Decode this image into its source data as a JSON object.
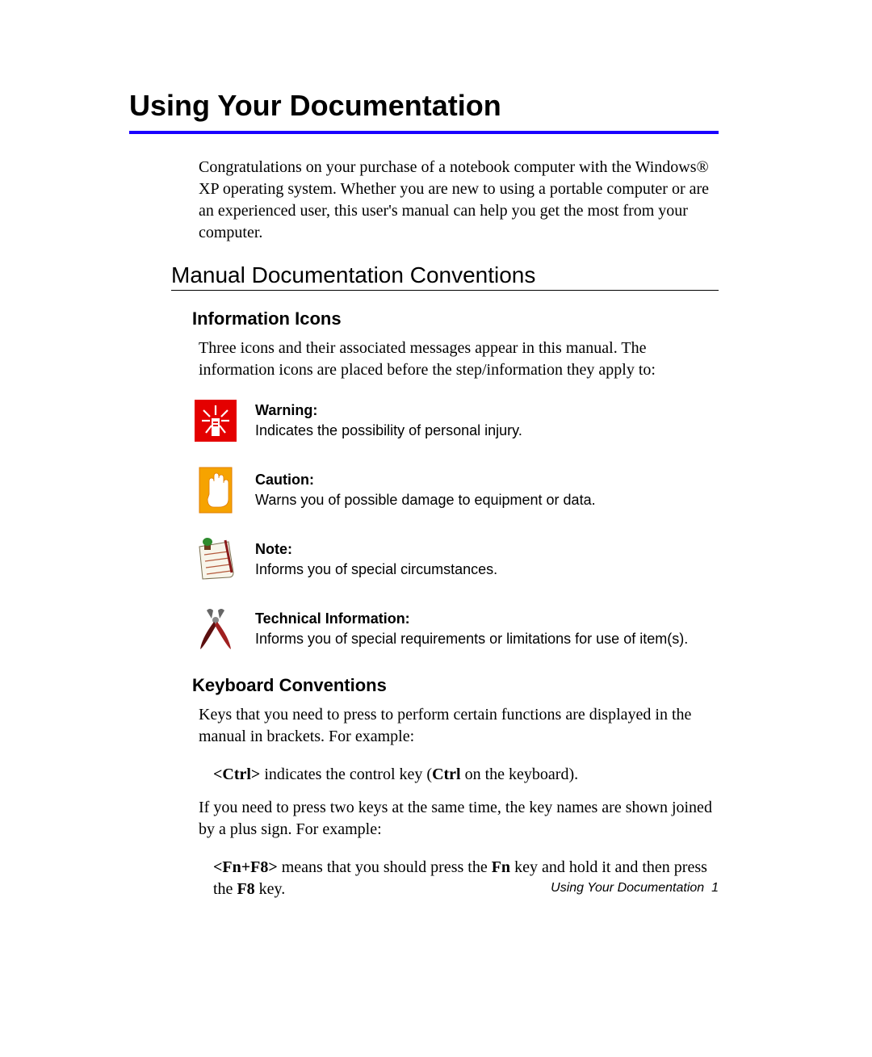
{
  "title": "Using Your Documentation",
  "intro": "Congratulations on your purchase of a notebook computer with the Windows® XP operating system. Whether you are new to using a portable computer or are an experienced user, this user's manual can help you get the most from your computer.",
  "section_heading": "Manual Documentation Conventions",
  "info_icons": {
    "heading": "Information Icons",
    "lead": "Three icons and their associated messages appear in this manual. The information icons are placed before the step/information they apply to:",
    "items": [
      {
        "icon": "warning-icon",
        "label": "Warning:",
        "desc": "Indicates the possibility of personal injury."
      },
      {
        "icon": "caution-icon",
        "label": "Caution:",
        "desc": "Warns you of possible damage to equipment or data."
      },
      {
        "icon": "note-icon",
        "label": "Note:",
        "desc": "Informs you of special circumstances."
      },
      {
        "icon": "tech-info-icon",
        "label": "Technical Information:",
        "desc": "Informs you of special requirements or limitations for use of item(s)."
      }
    ]
  },
  "keyboard": {
    "heading": "Keyboard Conventions",
    "p1": "Keys that you need to press to perform certain functions are displayed in the manual in brackets. For example:",
    "ex1_key": "<Ctrl>",
    "ex1_mid": " indicates the control key (",
    "ex1_bold": "Ctrl",
    "ex1_end": " on the keyboard).",
    "p2": "If you need to press two keys at the same time, the key names are shown joined by a plus sign. For example:",
    "ex2_key": "<Fn+F8>",
    "ex2_a": " means that you should press the ",
    "ex2_fn": "Fn",
    "ex2_b": " key and hold it and then press the ",
    "ex2_f8": "F8",
    "ex2_c": " key."
  },
  "footer": {
    "text": "Using Your Documentation",
    "page": "1"
  }
}
